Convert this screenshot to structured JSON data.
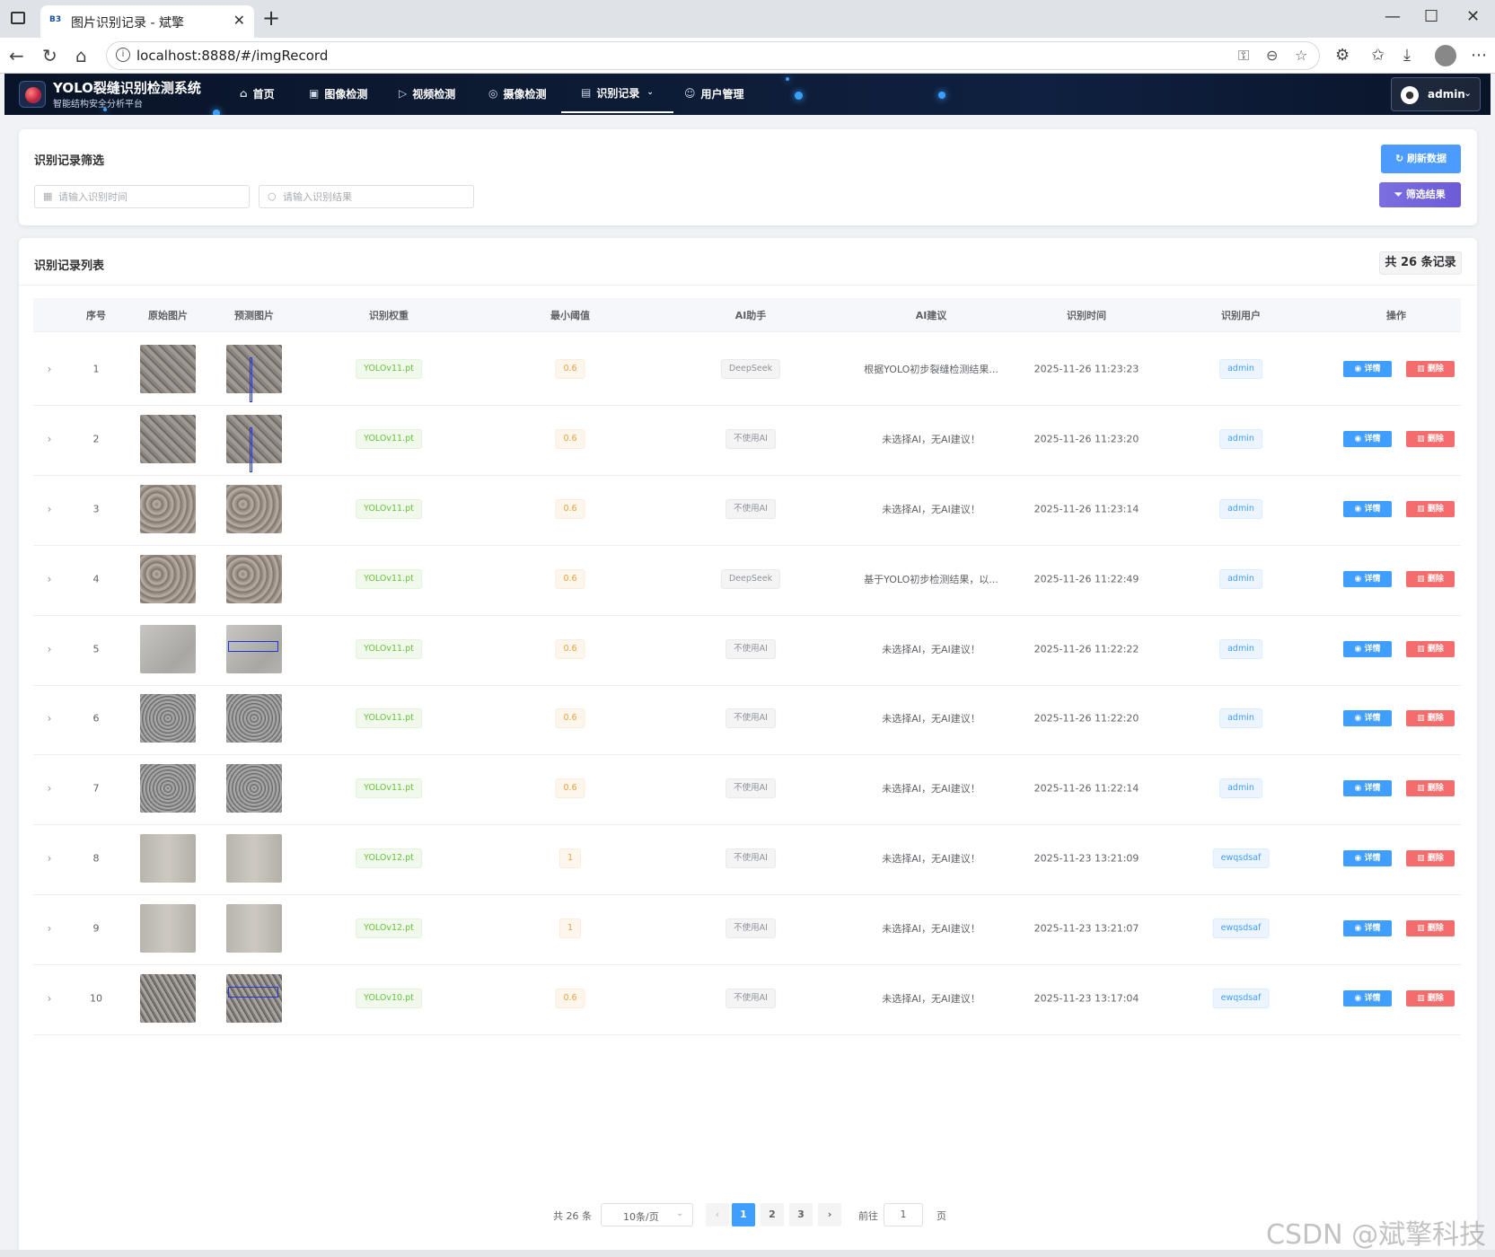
{
  "browser": {
    "tab_title": "图片识别记录 - 斌擎",
    "tab_favicon": "B3",
    "url": "localhost:8888/#/imgRecord"
  },
  "app": {
    "brand_title": "YOLO裂缝识别检测系统",
    "brand_subtitle": "智能结构安全分析平台",
    "nav": [
      {
        "label": "首页",
        "icon": "home-icon"
      },
      {
        "label": "图像检测",
        "icon": "image-icon"
      },
      {
        "label": "视频检测",
        "icon": "video-icon"
      },
      {
        "label": "摄像检测",
        "icon": "camera-icon"
      },
      {
        "label": "识别记录",
        "icon": "document-icon",
        "active": true
      },
      {
        "label": "用户管理",
        "icon": "users-icon"
      }
    ],
    "user": "admin"
  },
  "filter": {
    "title": "识别记录筛选",
    "time_placeholder": "请输入识别时间",
    "result_placeholder": "请输入识别结果",
    "refresh_label": "刷新数据",
    "filter_label": "筛选结果"
  },
  "list": {
    "title": "识别记录列表",
    "count_label": "共 26 条记录",
    "columns": [
      "序号",
      "原始图片",
      "预测图片",
      "识别权重",
      "最小阈值",
      "AI助手",
      "AI建议",
      "识别时间",
      "识别用户",
      "操作"
    ],
    "detail_label": "详情",
    "delete_label": "删除",
    "rows": [
      {
        "idx": "1",
        "weight": "YOLOv11.pt",
        "threshold": "0.6",
        "ai": "DeepSeek",
        "advice": "根据YOLO初步裂缝检测结果...",
        "time": "2025-11-26 11:23:23",
        "user": "admin",
        "img": "concrete"
      },
      {
        "idx": "2",
        "weight": "YOLOv11.pt",
        "threshold": "0.6",
        "ai": "不使用AI",
        "advice": "未选择AI，无AI建议！",
        "time": "2025-11-26 11:23:20",
        "user": "admin",
        "img": "concrete"
      },
      {
        "idx": "3",
        "weight": "YOLOv11.pt",
        "threshold": "0.6",
        "ai": "不使用AI",
        "advice": "未选择AI，无AI建议！",
        "time": "2025-11-26 11:23:14",
        "user": "admin",
        "img": "rough"
      },
      {
        "idx": "4",
        "weight": "YOLOv11.pt",
        "threshold": "0.6",
        "ai": "DeepSeek",
        "advice": "基于YOLO初步检测结果，以...",
        "time": "2025-11-26 11:22:49",
        "user": "admin",
        "img": "rough"
      },
      {
        "idx": "5",
        "weight": "YOLOv11.pt",
        "threshold": "0.6",
        "ai": "不使用AI",
        "advice": "未选择AI，无AI建议！",
        "time": "2025-11-26 11:22:22",
        "user": "admin",
        "img": "smooth"
      },
      {
        "idx": "6",
        "weight": "YOLOv11.pt",
        "threshold": "0.6",
        "ai": "不使用AI",
        "advice": "未选择AI，无AI建议！",
        "time": "2025-11-26 11:22:20",
        "user": "admin",
        "img": "gravel"
      },
      {
        "idx": "7",
        "weight": "YOLOv11.pt",
        "threshold": "0.6",
        "ai": "不使用AI",
        "advice": "未选择AI，无AI建议！",
        "time": "2025-11-26 11:22:14",
        "user": "admin",
        "img": "gravel"
      },
      {
        "idx": "8",
        "weight": "YOLOv12.pt",
        "threshold": "1",
        "ai": "不使用AI",
        "advice": "未选择AI，无AI建议！",
        "time": "2025-11-23 13:21:09",
        "user": "ewqsdsaf",
        "img": "plain"
      },
      {
        "idx": "9",
        "weight": "YOLOv12.pt",
        "threshold": "1",
        "ai": "不使用AI",
        "advice": "未选择AI，无AI建议！",
        "time": "2025-11-23 13:21:07",
        "user": "ewqsdsaf",
        "img": "plain"
      },
      {
        "idx": "10",
        "weight": "YOLOv10.pt",
        "threshold": "0.6",
        "ai": "不使用AI",
        "advice": "未选择AI，无AI建议！",
        "time": "2025-11-23 13:17:04",
        "user": "ewqsdsaf",
        "img": "cracked"
      }
    ]
  },
  "pagination": {
    "total": "共 26 条",
    "page_size": "10条/页",
    "pages": [
      "1",
      "2",
      "3"
    ],
    "current": "1",
    "goto_label": "前往",
    "goto_value": "1",
    "page_suffix": "页"
  },
  "watermark": "CSDN @斌擎科技"
}
